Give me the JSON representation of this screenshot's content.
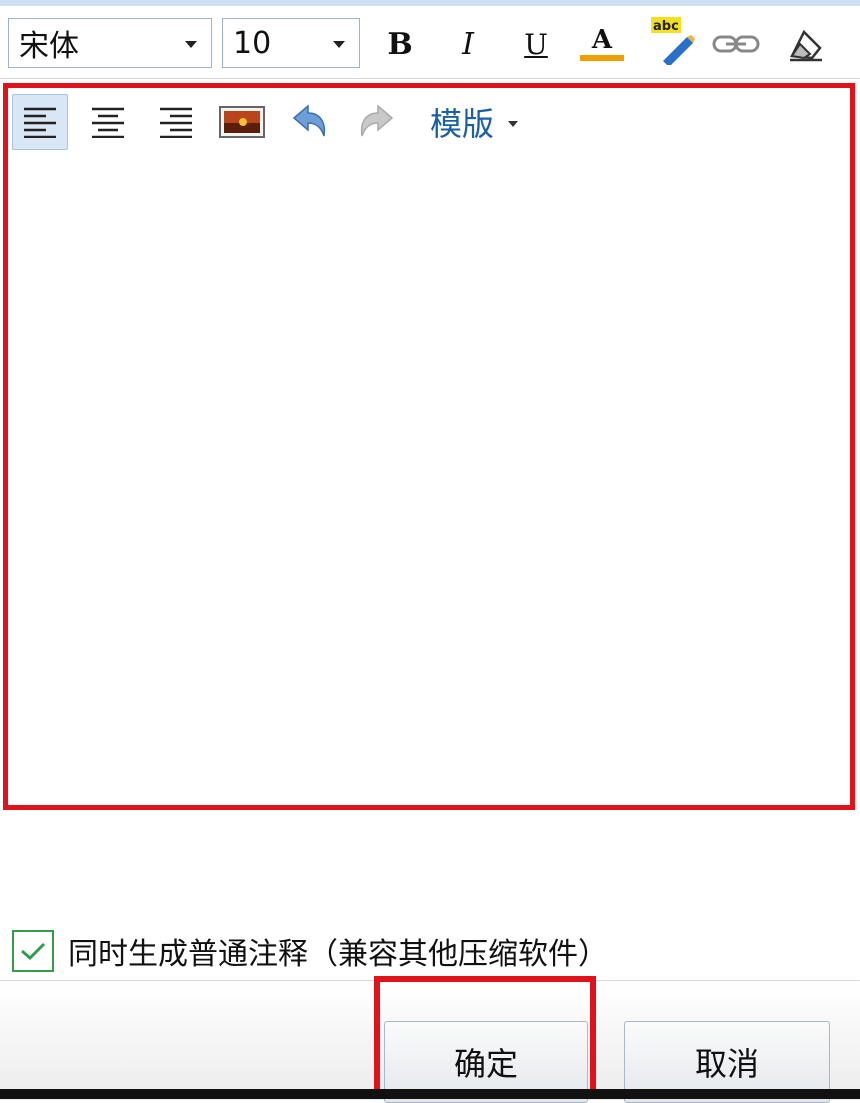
{
  "format_toolbar": {
    "font_family": "宋体",
    "font_size": "10",
    "buttons": [
      {
        "name": "bold-button",
        "icon": "bold-icon",
        "label": "B"
      },
      {
        "name": "italic-button",
        "icon": "italic-icon",
        "label": "I"
      },
      {
        "name": "underline-button",
        "icon": "underline-icon",
        "label": "U"
      },
      {
        "name": "font-color-button",
        "icon": "font-color-icon",
        "label": "A"
      },
      {
        "name": "spellcheck-button",
        "icon": "spellcheck-icon",
        "label": "abc"
      },
      {
        "name": "link-button",
        "icon": "link-icon"
      },
      {
        "name": "clear-format-button",
        "icon": "eraser-icon"
      }
    ]
  },
  "edit_toolbar": {
    "align_left": {
      "icon": "align-left-icon",
      "active": true
    },
    "align_center": {
      "icon": "align-center-icon"
    },
    "align_right": {
      "icon": "align-right-icon"
    },
    "insert_image": {
      "icon": "image-icon"
    },
    "undo": {
      "icon": "undo-icon"
    },
    "redo": {
      "icon": "redo-icon",
      "disabled": true
    },
    "template_label": "模版"
  },
  "editor": {
    "content": ""
  },
  "options": {
    "generate_plain_comment": {
      "label": "同时生成普通注释（兼容其他压缩软件）",
      "checked": true
    }
  },
  "dialog_buttons": {
    "ok": "确定",
    "cancel": "取消"
  },
  "colors": {
    "highlight": "#e0131b",
    "link_blue": "#1a5fa8",
    "checkbox_green": "#2e9e4a",
    "font_color_bar": "#f0a000"
  }
}
